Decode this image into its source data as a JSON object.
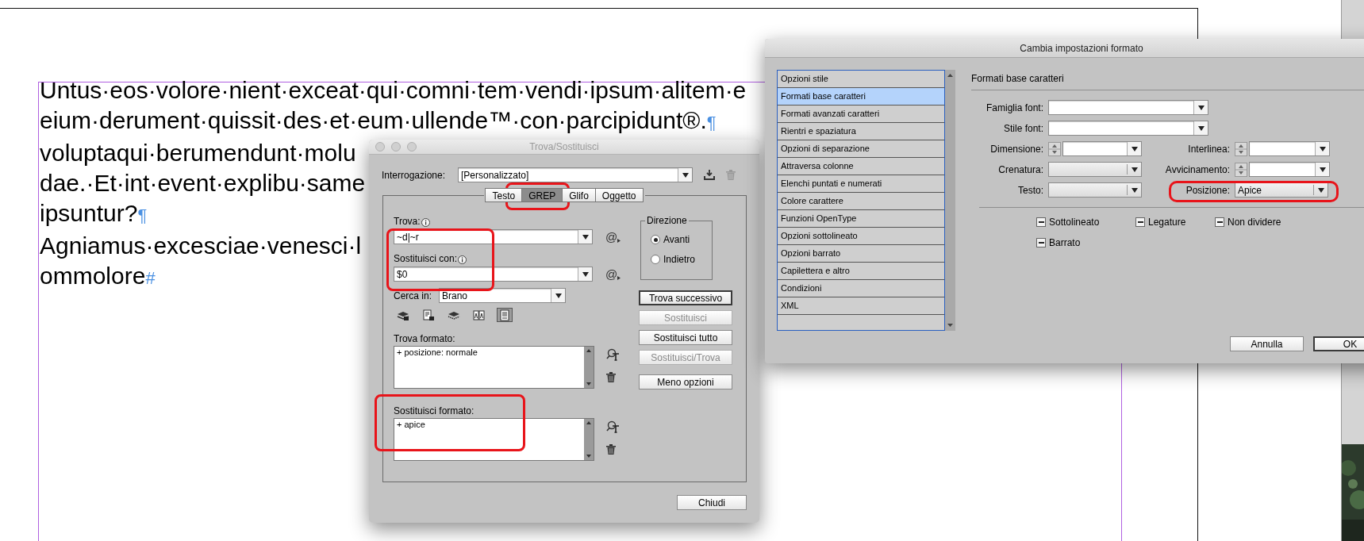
{
  "document": {
    "lines": [
      {
        "text": "Untus·eos·volore·nient·exceat·qui·comni·tem·vendi·ipsum·alitem·e"
      },
      {
        "text": "eium·derument·quissit·des·et·eum·ullende™·con·parcipidunt®.",
        "mark": "¶"
      },
      {
        "text": "voluptaqui·berumendunt·molu"
      },
      {
        "text": "dae.·Et·int·event·explibu·same"
      },
      {
        "text": "ipsuntur?",
        "mark": "¶"
      },
      {
        "text": "Agniamus·excesciae·venesci·l"
      },
      {
        "text": "ommolore",
        "mark": "#"
      }
    ]
  },
  "find_replace": {
    "title": "Trova/Sostituisci",
    "query": {
      "label": "Interrogazione:",
      "value": "[Personalizzato]"
    },
    "tabs": [
      {
        "label": "Testo",
        "selected": false
      },
      {
        "label": "GREP",
        "selected": true
      },
      {
        "label": "Glifo",
        "selected": false
      },
      {
        "label": "Oggetto",
        "selected": false
      }
    ],
    "find": {
      "label": "Trova:",
      "value": "~d|~r",
      "glyph": "@"
    },
    "replace": {
      "label": "Sostituisci con:",
      "value": "$0",
      "glyph": "@"
    },
    "search_in": {
      "label": "Cerca in:",
      "value": "Brano"
    },
    "toggles": [
      {
        "kind": "locked-layers",
        "on": false
      },
      {
        "kind": "locked-stories",
        "on": false
      },
      {
        "kind": "hidden-layers",
        "on": false
      },
      {
        "kind": "master-pages",
        "on": false
      },
      {
        "kind": "footnotes",
        "on": true
      }
    ],
    "direction": {
      "title": "Direzione",
      "options": [
        {
          "label": "Avanti",
          "selected": true
        },
        {
          "label": "Indietro",
          "selected": false
        }
      ]
    },
    "buttons": [
      {
        "label": "Trova successivo",
        "default": true,
        "disabled": false
      },
      {
        "label": "Sostituisci",
        "default": false,
        "disabled": true
      },
      {
        "label": "Sostituisci tutto",
        "default": false,
        "disabled": false
      },
      {
        "label": "Sostituisci/Trova",
        "default": false,
        "disabled": true
      },
      {
        "label": "Meno opzioni",
        "default": false,
        "disabled": false
      }
    ],
    "find_format": {
      "label": "Trova formato:",
      "items": [
        "+ posizione: normale"
      ]
    },
    "replace_format": {
      "label": "Sostituisci formato:",
      "items": [
        "+ apice"
      ]
    },
    "close_button": "Chiudi"
  },
  "format_dialog": {
    "title": "Cambia impostazioni formato",
    "categories": [
      {
        "label": "Opzioni stile",
        "selected": false
      },
      {
        "label": "Formati base caratteri",
        "selected": true
      },
      {
        "label": "Formati avanzati caratteri",
        "selected": false
      },
      {
        "label": "Rientri e spaziatura",
        "selected": false
      },
      {
        "label": "Opzioni di separazione",
        "selected": false
      },
      {
        "label": "Attraversa colonne",
        "selected": false
      },
      {
        "label": "Elenchi puntati e numerati",
        "selected": false
      },
      {
        "label": "Colore carattere",
        "selected": false
      },
      {
        "label": "Funzioni OpenType",
        "selected": false
      },
      {
        "label": "Opzioni sottolineato",
        "selected": false
      },
      {
        "label": "Opzioni barrato",
        "selected": false
      },
      {
        "label": "Capilettera e altro",
        "selected": false
      },
      {
        "label": "Condizioni",
        "selected": false
      },
      {
        "label": "XML",
        "selected": false
      }
    ],
    "section_title": "Formati base caratteri",
    "rows": [
      [
        {
          "label": "Famiglia font:",
          "kind": "combo"
        }
      ],
      [
        {
          "label": "Stile font:",
          "kind": "combo"
        }
      ],
      [
        {
          "label": "Dimensione:",
          "kind": "spin"
        },
        {
          "label": "Interlinea:",
          "kind": "spin"
        }
      ],
      [
        {
          "label": "Crenatura:",
          "kind": "select"
        },
        {
          "label": "Avvicinamento:",
          "kind": "spin"
        }
      ],
      [
        {
          "label": "Testo:",
          "kind": "select"
        },
        {
          "label": "Posizione:",
          "kind": "select",
          "value": "Apice"
        }
      ]
    ],
    "checkboxes": [
      {
        "label": "Sottolineato",
        "indeterminate": true
      },
      {
        "label": "Legature",
        "indeterminate": true
      },
      {
        "label": "Non dividere",
        "indeterminate": true
      },
      {
        "label": "Barrato",
        "indeterminate": true
      }
    ],
    "buttons": [
      {
        "label": "Annulla",
        "default": false
      },
      {
        "label": "OK",
        "default": true
      }
    ]
  }
}
